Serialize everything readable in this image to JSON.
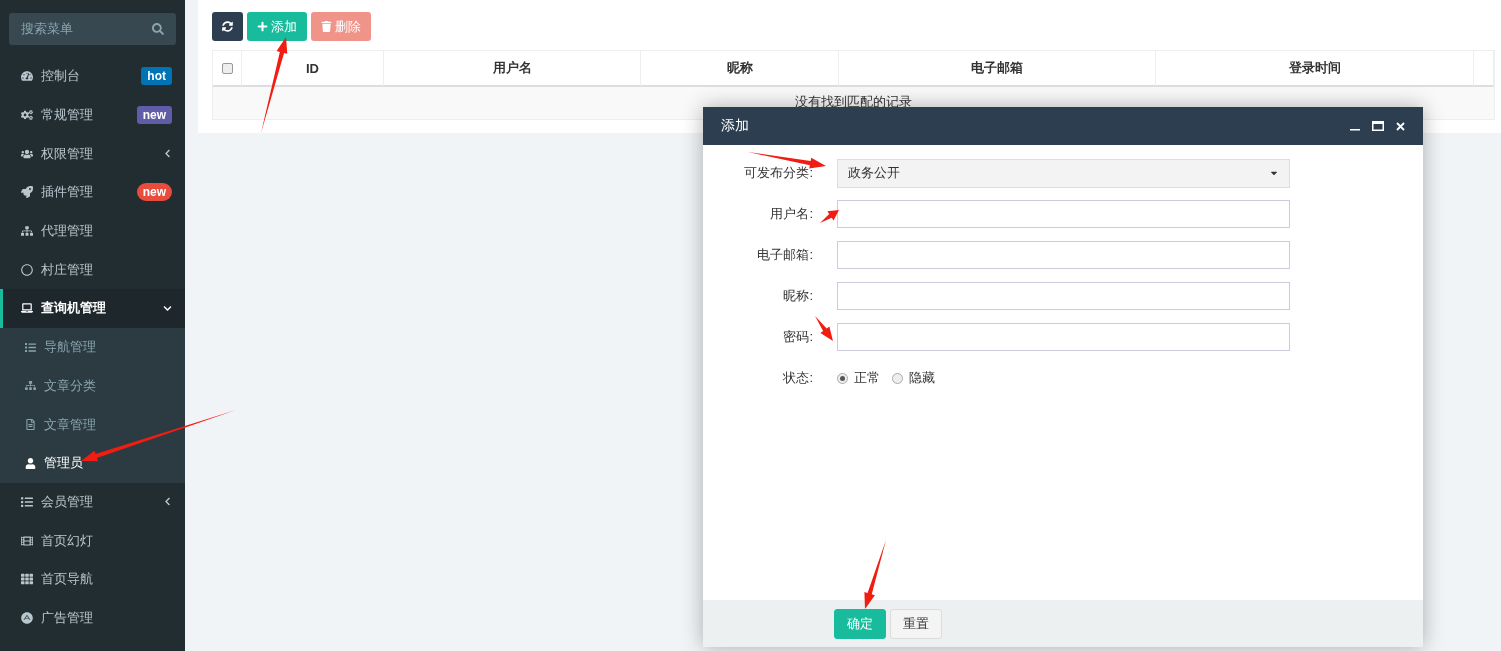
{
  "sidebar": {
    "search": {
      "placeholder": "搜索菜单"
    },
    "items": [
      {
        "label": "控制台",
        "badge": {
          "text": "hot",
          "color": "#0073b7"
        },
        "selected": false
      },
      {
        "label": "常规管理",
        "badge": {
          "text": "new",
          "color": "#605ca8"
        },
        "selected": false
      },
      {
        "label": "权限管理",
        "expanded": false,
        "selected": false
      },
      {
        "label": "插件管理",
        "badge": {
          "text": "new",
          "color": "#e74c3c",
          "pill": true
        },
        "selected": false
      },
      {
        "label": "代理管理",
        "selected": false
      },
      {
        "label": "村庄管理",
        "selected": false
      },
      {
        "label": "查询机管理",
        "expanded": true,
        "selected": true,
        "children": [
          {
            "label": "导航管理",
            "selected": false
          },
          {
            "label": "文章分类",
            "selected": false
          },
          {
            "label": "文章管理",
            "selected": false
          },
          {
            "label": "管理员",
            "selected": true
          }
        ]
      },
      {
        "label": "会员管理",
        "expanded": false,
        "selected": false
      },
      {
        "label": "首页幻灯",
        "selected": false
      },
      {
        "label": "首页导航",
        "selected": false
      },
      {
        "label": "广告管理",
        "selected": false
      }
    ]
  },
  "toolbar": {
    "buttons": [
      {
        "kind": "refresh"
      },
      {
        "kind": "add",
        "label": "添加"
      },
      {
        "kind": "delete",
        "label": "删除",
        "disabled": true
      }
    ]
  },
  "table": {
    "columns": [
      "ID",
      "用户名",
      "昵称",
      "电子邮箱",
      "登录时间"
    ],
    "header_checked": false,
    "empty_message": "没有找到匹配的记录"
  },
  "dialog": {
    "title": "添加",
    "fields": [
      {
        "kind": "select",
        "label": "可发布分类:",
        "value": "政务公开"
      },
      {
        "kind": "text",
        "label": "用户名:"
      },
      {
        "kind": "text",
        "label": "电子邮箱:"
      },
      {
        "kind": "text",
        "label": "昵称:"
      },
      {
        "kind": "text",
        "label": "密码:"
      },
      {
        "kind": "radio",
        "label": "状态:",
        "options": [
          {
            "label": "正常",
            "selected": true
          },
          {
            "label": "隐藏",
            "selected": false
          }
        ]
      }
    ],
    "buttons": [
      {
        "kind": "primary",
        "label": "确定"
      },
      {
        "kind": "default",
        "label": "重置"
      }
    ]
  }
}
